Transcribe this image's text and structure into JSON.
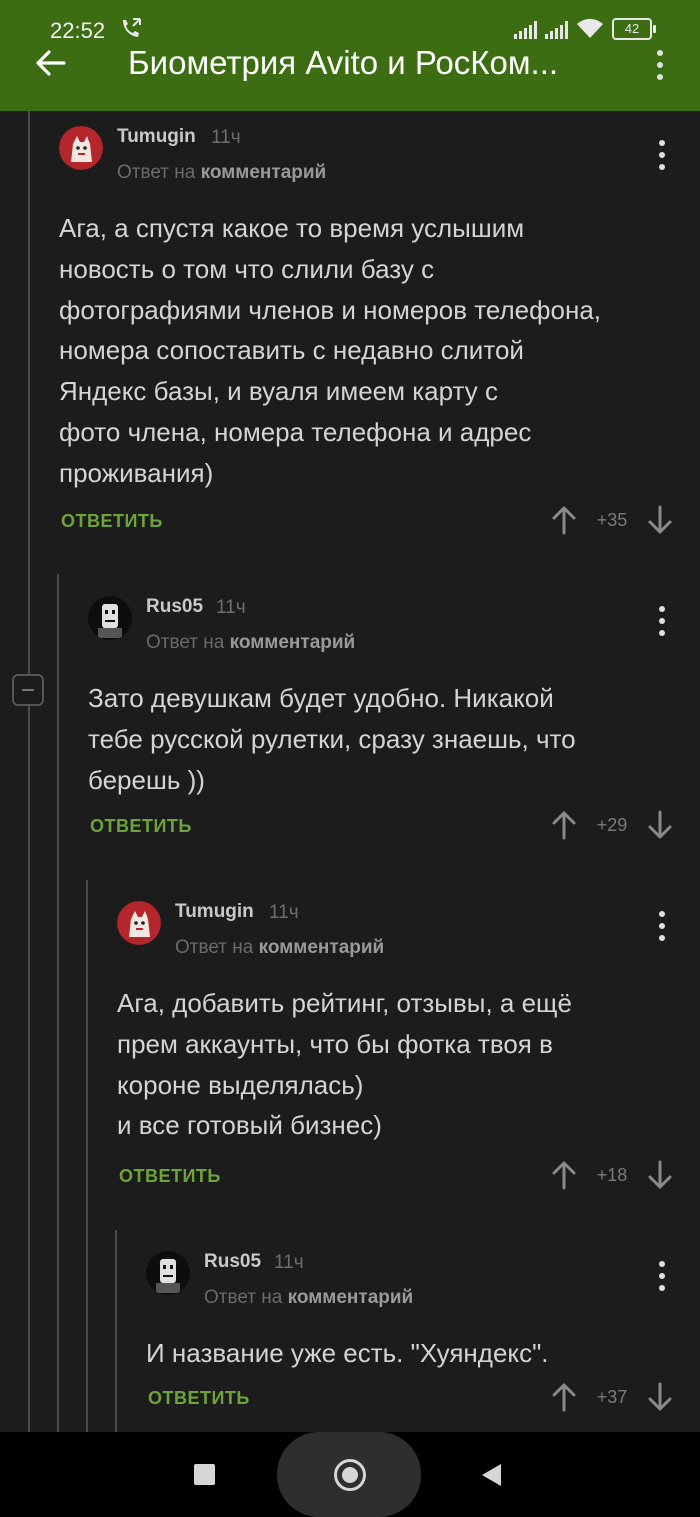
{
  "status_bar": {
    "time": "22:52",
    "battery": "42"
  },
  "app_bar": {
    "title": "Биометрия Avito и РосКом..."
  },
  "comments": [
    {
      "author": "Tumugin",
      "time": "11ч",
      "reply_prefix": "Ответ на",
      "reply_link": "комментарий",
      "body": [
        "Ага, а спустя какое то время услышим",
        "новость о том что слили базу с",
        "фотографиями членов и номеров телефона,",
        "номера сопоставить с недавно слитой",
        "Яндекс базы, и вуаля имеем карту с",
        "фото члена, номера телефона и адрес",
        "проживания)"
      ],
      "reply_label": "ОТВЕТИТЬ",
      "rating": "+35"
    },
    {
      "author": "Rus05",
      "time": "11ч",
      "reply_prefix": "Ответ на",
      "reply_link": "комментарий",
      "body": [
        "Зато девушкам будет удобно. Никакой",
        "тебе русской рулетки, сразу знаешь, что",
        "берешь ))"
      ],
      "reply_label": "ОТВЕТИТЬ",
      "rating": "+29"
    },
    {
      "author": "Tumugin",
      "time": "11ч",
      "reply_prefix": "Ответ на",
      "reply_link": "комментарий",
      "body": [
        "Ага, добавить рейтинг, отзывы, а ещё",
        "прем аккаунты, что бы фотка твоя в",
        "короне выделялась)",
        "и все готовый бизнес)"
      ],
      "reply_label": "ОТВЕТИТЬ",
      "rating": "+18"
    },
    {
      "author": "Rus05",
      "time": "11ч",
      "reply_prefix": "Ответ на",
      "reply_link": "комментарий",
      "body": [
        "И название уже есть. \"Хуяндекс\"."
      ],
      "reply_label": "ОТВЕТИТЬ",
      "rating": "+37"
    }
  ],
  "icons": {
    "back": "arrow-back-icon",
    "menu": "more-vert-icon",
    "upvote": "arrow-up-icon",
    "downvote": "arrow-down-icon",
    "collapse": "collapse-minus-icon"
  },
  "colors": {
    "app_bar": "#3d6d12",
    "background": "#1c1c1c",
    "reply_accent": "#6ea33a",
    "text": "#d4d4d4"
  }
}
